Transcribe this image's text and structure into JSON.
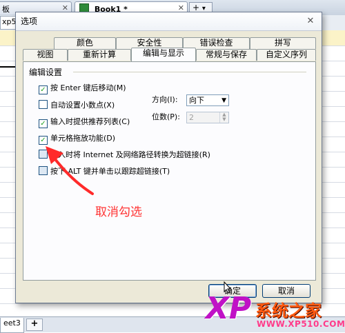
{
  "app": {
    "tabs": [
      {
        "label": "板"
      },
      {
        "label": "Book1 *"
      }
    ],
    "name_box": "xp5",
    "sheet_tab": "eet3",
    "close_glyph": "✕",
    "add_glyph": "+",
    "dropdown_glyph": "▾"
  },
  "dialog": {
    "title": "选项",
    "tabs_row1": [
      "颜色",
      "安全性",
      "错误检查",
      "拼写"
    ],
    "tabs_row2": [
      "视图",
      "重新计算",
      "编辑与显示",
      "常规与保存",
      "自定义序列"
    ],
    "active_tab": "编辑与显示",
    "group_title": "编辑设置",
    "options": [
      {
        "label": "按 Enter 键后移动(M)",
        "checked": true
      },
      {
        "label": "自动设置小数点(X)",
        "checked": false
      },
      {
        "label": "输入时提供推荐列表(C)",
        "checked": true
      },
      {
        "label": "单元格拖放功能(D)",
        "checked": true
      },
      {
        "label": "键入时将 Internet 及网络路径转换为超链接(R)",
        "checked": false
      },
      {
        "label": "按下 ALT 键并单击以跟踪超链接(T)",
        "checked": false
      }
    ],
    "direction_label": "方向(I):",
    "direction_value": "向下",
    "decimals_label": "位数(P):",
    "decimals_value": "2",
    "ok_label": "确定",
    "cancel_label": "取消"
  },
  "annotation": {
    "text": "取消勾选",
    "color": "#ff3333"
  },
  "watermark": {
    "logo": "XP",
    "site_name": "系统之家",
    "url": "WWW.XP510.COM"
  },
  "colors": {
    "accent_blue": "#003c74",
    "check_green": "#21a121",
    "watermark_pink": "#c012c6",
    "watermark_orange": "#ff5a10"
  }
}
